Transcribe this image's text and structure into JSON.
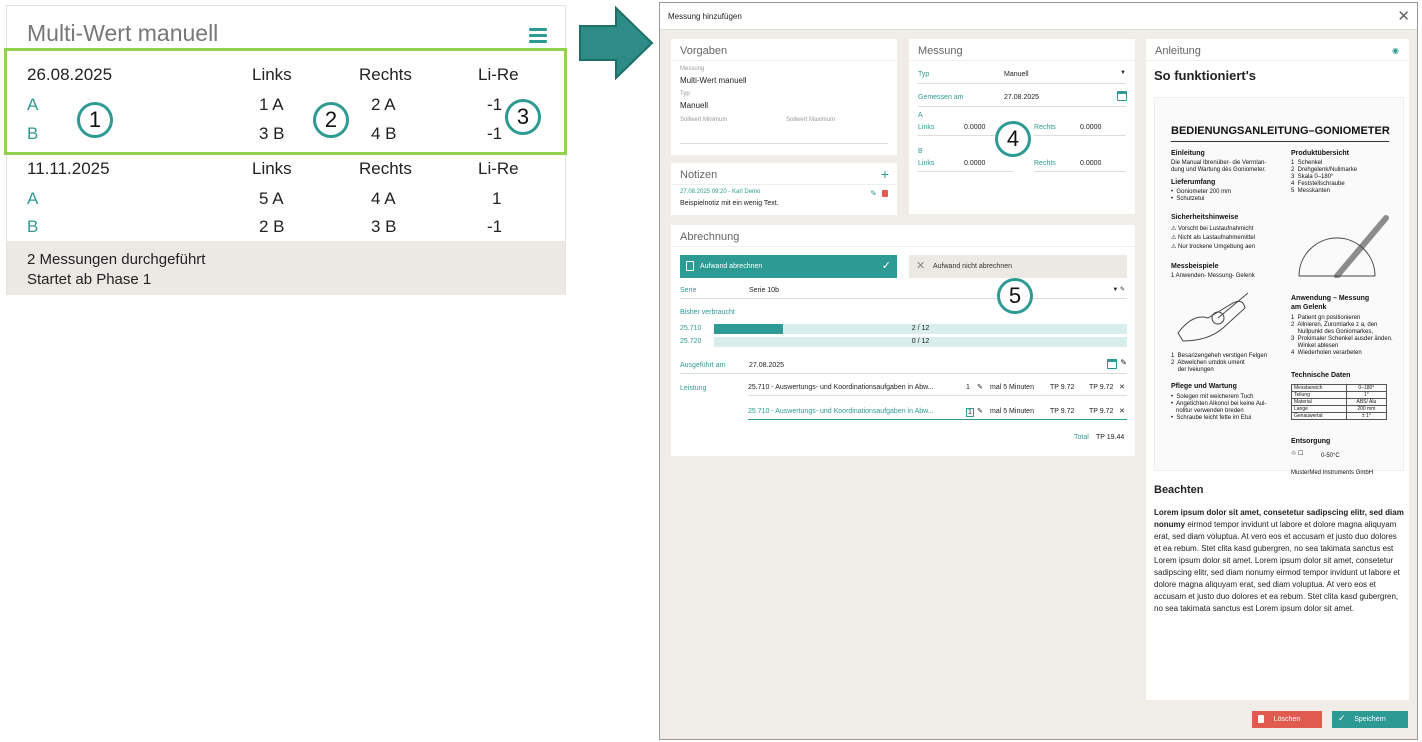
{
  "left": {
    "title": "Multi-Wert manuell",
    "menu_icon": "hamburger-icon",
    "groups": [
      {
        "date": "26.08.2025",
        "h1": "Links",
        "h2": "Rechts",
        "h3": "Li-Re",
        "rows": [
          {
            "name": "A",
            "l": "1 A",
            "r": "2 A",
            "d": "-1"
          },
          {
            "name": "B",
            "l": "3 B",
            "r": "4 B",
            "d": "-1"
          }
        ]
      },
      {
        "date": "11.11.2025",
        "h1": "Links",
        "h2": "Rechts",
        "h3": "Li-Re",
        "rows": [
          {
            "name": "A",
            "l": "5 A",
            "r": "4 A",
            "d": "1"
          },
          {
            "name": "B",
            "l": "2 B",
            "r": "3 B",
            "d": "-1"
          }
        ]
      }
    ],
    "footer1": "2 Messungen durchgeführt",
    "footer2": "Startet ab Phase 1"
  },
  "markers": [
    "1",
    "2",
    "3",
    "4",
    "5"
  ],
  "colors": {
    "accent": "#2e9a94",
    "highlight": "#92d050",
    "danger": "#e05a4f"
  },
  "dialog": {
    "title": "Messung hinzufügen",
    "close": "✕",
    "vorgaben": {
      "title": "Vorgaben",
      "messung_label": "Messung",
      "messung": "Multi-Wert manuell",
      "typ_label": "Typ",
      "typ": "Manuell",
      "smin": "Sollwert Minimum",
      "smax": "Sollwert Maximum"
    },
    "notizen": {
      "title": "Notizen",
      "add": "+",
      "meta": "27.08.2025 09:20 - Karl Demo",
      "text": "Beispielnotiz mit ein wenig Text."
    },
    "messung": {
      "title": "Messung",
      "typ_label": "Typ",
      "typ": "Manuell",
      "gem_label": "Gemessen am",
      "gem": "27.08.2025",
      "a": "A",
      "b": "B",
      "links": "Links",
      "rechts": "Rechts",
      "a_l": "0.0000",
      "a_r": "0.0000",
      "b_l": "0.0000",
      "b_r": "0.0000"
    },
    "abr": {
      "title": "Abrechnung",
      "btn_on": "Aufwand abrechnen",
      "btn_off": "Aufwand nicht abrechnen",
      "serie_label": "Serie",
      "serie": "Serie 10b",
      "bisher": "Bisher verbraucht",
      "bars": [
        {
          "code": "25.710",
          "text": "2 / 12",
          "frac": 0.167
        },
        {
          "code": "25.720",
          "text": "0 / 12",
          "frac": 0
        }
      ],
      "ausg_label": "Ausgeführt am",
      "ausg": "27.08.2025",
      "leistung_label": "Leistung",
      "items": [
        {
          "text": "25.710 - Auswertungs- und Koordinationsaufgaben in Abw...",
          "qty": "1",
          "unit": "mal 5 Minuten",
          "tp1": "TP 9.72",
          "tp2": "TP 9.72"
        },
        {
          "text": "25.710 - Auswertungs- und Koordinationsaufgaben in Abw...",
          "qty": "1",
          "unit": "mal 5 Minuten",
          "tp1": "TP 9.72",
          "tp2": "TP 9.72"
        }
      ],
      "total_label": "Total",
      "total": "TP 19.44"
    },
    "anl": {
      "title": "Anleitung",
      "heading": "So funktioniert's",
      "m_title": "BEDIENUNGSANLEITUNG–GONIOMETER",
      "m_einl": "Einleitung",
      "m_einl_t": "Die Manual Ibrenüber- die Verrnlan-\ndung und Wartung dès Goniometer.",
      "m_lief": "Lieferumfang",
      "m_lief_t": "•  Goniometer 200 mm\n•  Schutzetui",
      "m_sich": "Sicherheitshinweise",
      "m_sich_t": "⚠ Vorscht bei Lustaufnahmicht\n⚠ Nicht als Lastaufnahmemittel\n⚠ Nur trockene Umgebung aen",
      "m_mess": "Messbeispiele",
      "m_mess_t": "1  Anwenden- Messung- Gelenk",
      "m_mess_t2": "1  Besarizengeheh verstigen Felgen\n2  Abwelchen umdok ument\n    der lveiungen",
      "m_pfl": "Pflege und Wartung",
      "m_pfl_t": "•  Solegen mit weicherem Tuch\n•  Angetichten Alkonol bei keine Aul-\n   nolitur verwenden breden\n•  Schraube leicht fette im Etui",
      "m_prod": "Produktübersicht",
      "m_prod_t": "1  Schenkel\n2  Drehgelenk/Nulimarke\n3  Skala 0–180°\n4  Feststellschraube\n5  Messkanten",
      "m_anw": "Anwendung – Messung\nam Gelenk",
      "m_anw_t": "1  Patient gn positionieren\n2  Allnieren, Zuromlarke z a, den\n    Nullpunkt des Goniomarkes,\n3  Prokimaler Schenkel ausder änden.\n    Winkel ablesen\n4  Wiederholen verarbeten",
      "m_tech": "Technische Daten",
      "m_table": [
        [
          "Messbereich",
          "0–180°"
        ],
        [
          "Teilung",
          "1°"
        ],
        [
          "Material",
          "ABS/ Alu"
        ],
        [
          "Lange",
          "200 mm"
        ],
        [
          "Genauwertat",
          "± 1°"
        ]
      ],
      "m_ents": "Entsorgung",
      "m_ents_t": "0-50°C",
      "m_brand": "MusterMed Instruments GmbH",
      "beachten": "Beachten",
      "text_bold": "Lorem ipsum dolor sit amet, consetetur sadipscing elitr, sed diam nonumy",
      "text": " eirmod tempor invidunt ut labore et dolore magna aliquyam erat, sed diam voluptua. At vero eos et accusam et justo duo dolores et ea rebum. Stet clita kasd gubergren, no sea takimata sanctus est Lorem ipsum dolor sit amet. Lorem ipsum dolor sit amet, consetetur sadipscing elitr, sed diam nonumy eirmod tempor invidunt ut labore et dolore magna aliquyam erat, sed diam voluptua. At vero eos et accusam et justo duo dolores et ea rebum. Stet clita kasd gubergren, no sea takimata sanctus est Lorem ipsum dolor sit amet."
    },
    "btn_delete": "Löschen",
    "btn_save": "Speichern"
  }
}
